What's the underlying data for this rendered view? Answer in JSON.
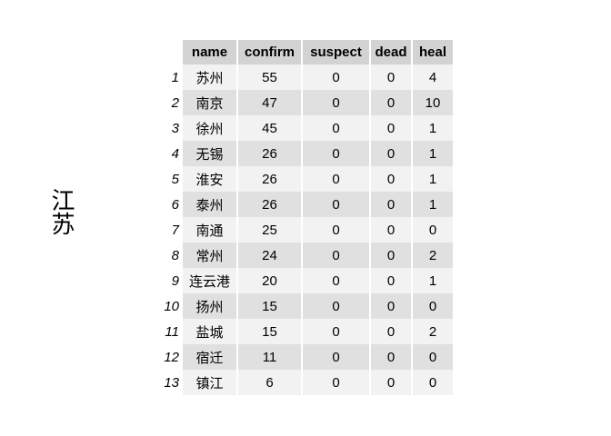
{
  "side_label": "江苏",
  "chart_data": {
    "type": "table",
    "columns": [
      "name",
      "confirm",
      "suspect",
      "dead",
      "heal"
    ],
    "rows": [
      {
        "index": "1",
        "name": "苏州",
        "confirm": 55,
        "suspect": 0,
        "dead": 0,
        "heal": 4
      },
      {
        "index": "2",
        "name": "南京",
        "confirm": 47,
        "suspect": 0,
        "dead": 0,
        "heal": 10
      },
      {
        "index": "3",
        "name": "徐州",
        "confirm": 45,
        "suspect": 0,
        "dead": 0,
        "heal": 1
      },
      {
        "index": "4",
        "name": "无锡",
        "confirm": 26,
        "suspect": 0,
        "dead": 0,
        "heal": 1
      },
      {
        "index": "5",
        "name": "淮安",
        "confirm": 26,
        "suspect": 0,
        "dead": 0,
        "heal": 1
      },
      {
        "index": "6",
        "name": "泰州",
        "confirm": 26,
        "suspect": 0,
        "dead": 0,
        "heal": 1
      },
      {
        "index": "7",
        "name": "南通",
        "confirm": 25,
        "suspect": 0,
        "dead": 0,
        "heal": 0
      },
      {
        "index": "8",
        "name": "常州",
        "confirm": 24,
        "suspect": 0,
        "dead": 0,
        "heal": 2
      },
      {
        "index": "9",
        "name": "连云港",
        "confirm": 20,
        "suspect": 0,
        "dead": 0,
        "heal": 1
      },
      {
        "index": "10",
        "name": "扬州",
        "confirm": 15,
        "suspect": 0,
        "dead": 0,
        "heal": 0
      },
      {
        "index": "11",
        "name": "盐城",
        "confirm": 15,
        "suspect": 0,
        "dead": 0,
        "heal": 2
      },
      {
        "index": "12",
        "name": "宿迁",
        "confirm": 11,
        "suspect": 0,
        "dead": 0,
        "heal": 0
      },
      {
        "index": "13",
        "name": "镇江",
        "confirm": 6,
        "suspect": 0,
        "dead": 0,
        "heal": 0
      }
    ]
  },
  "colors": {
    "header_bg": "#d3d3d3",
    "row_light": "#f2f2f2",
    "row_dark": "#e0e0e0"
  }
}
